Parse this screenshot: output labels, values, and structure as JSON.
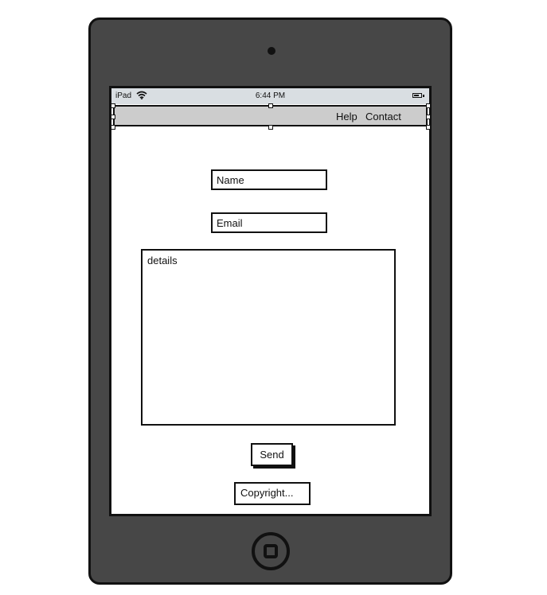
{
  "device": {
    "model": "iPad"
  },
  "statusbar": {
    "carrier": "iPad",
    "time": "6:44 PM"
  },
  "navbar": {
    "links": [
      "Help",
      "Contact"
    ]
  },
  "form": {
    "name_placeholder": "Name",
    "email_placeholder": "Email",
    "details_placeholder": "details",
    "send_label": "Send"
  },
  "footer": {
    "copyright": "Copyright..."
  },
  "colors": {
    "device_body": "#474747",
    "statusbar": "#d9dee2",
    "navbar": "#cccccc",
    "outline": "#111111"
  },
  "icons": [
    "wifi-icon",
    "battery-icon",
    "home-button-icon",
    "camera-icon"
  ]
}
